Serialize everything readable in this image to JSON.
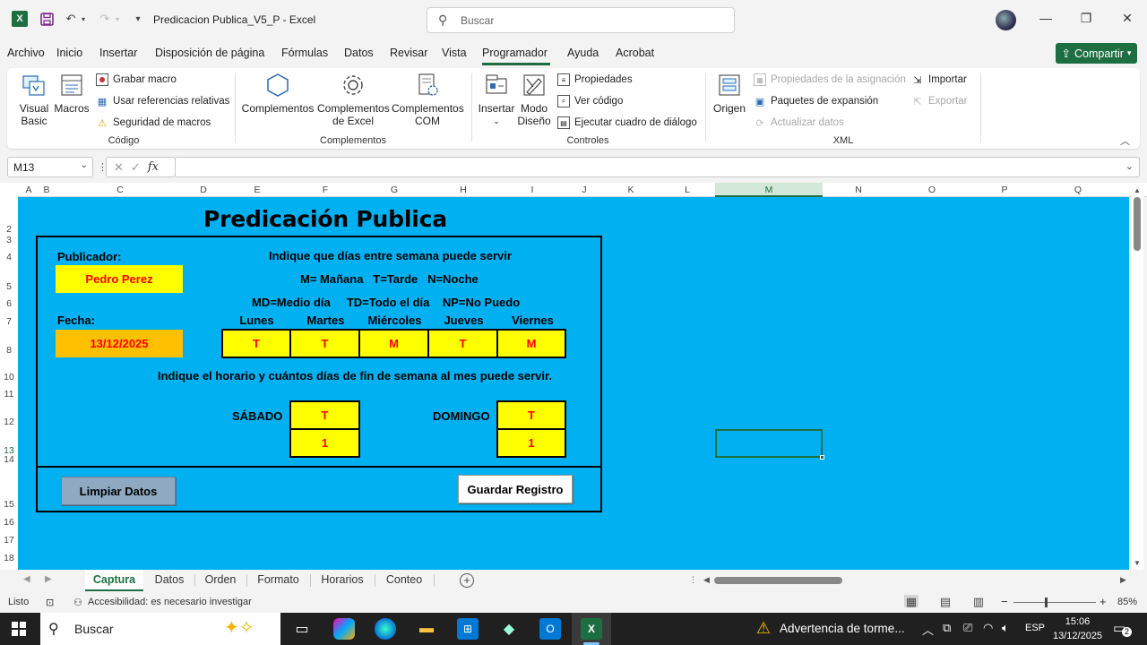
{
  "titlebar": {
    "app_letter": "X",
    "doc_title": "Predicacion Publica_V5_P  -  Excel",
    "search_placeholder": "Buscar"
  },
  "menu": {
    "items": [
      "Archivo",
      "Inicio",
      "Insertar",
      "Disposición de página",
      "Fórmulas",
      "Datos",
      "Revisar",
      "Vista",
      "Programador",
      "Ayuda",
      "Acrobat"
    ],
    "active": "Programador",
    "share_label": "Compartir"
  },
  "ribbon": {
    "codigo": {
      "visual_basic": "Visual Basic",
      "macros": "Macros",
      "grabar_macro": "Grabar macro",
      "usar_referencias": "Usar referencias relativas",
      "seguridad": "Seguridad de macros",
      "label": "Código"
    },
    "complementos": {
      "complementos": "Complementos",
      "complementos_excel": "Complementos de Excel",
      "complementos_com": "Complementos COM",
      "label": "Complementos"
    },
    "controles": {
      "insertar": "Insertar",
      "modo_diseno": "Modo Diseño",
      "propiedades": "Propiedades",
      "ver_codigo": "Ver código",
      "ejecutar_cuadro": "Ejecutar cuadro de diálogo",
      "label": "Controles"
    },
    "xml": {
      "origen": "Origen",
      "propiedades_asignacion": "Propiedades de la asignación",
      "paquetes_expansion": "Paquetes de expansión",
      "actualizar_datos": "Actualizar datos",
      "importar": "Importar",
      "exportar": "Exportar",
      "label": "XML"
    }
  },
  "formula_bar": {
    "name_box": "M13",
    "formula": ""
  },
  "columns": [
    "A",
    "B",
    "C",
    "D",
    "E",
    "F",
    "G",
    "H",
    "I",
    "J",
    "K",
    "L",
    "M",
    "N",
    "O",
    "P",
    "Q"
  ],
  "rows": [
    "2",
    "3",
    "4",
    "5",
    "6",
    "7",
    "8",
    "10",
    "11",
    "12",
    "13",
    "14",
    "15",
    "16",
    "17",
    "18"
  ],
  "sheet": {
    "title": "Predicación Publica",
    "publicador_label": "Publicador:",
    "publicador_value": "Pedro Perez",
    "fecha_label": "Fecha:",
    "fecha_value": "13/12/2025",
    "instruction_weekdays": "Indique que días entre semana puede servir",
    "legend_line1": "M= Mañana   T=Tarde   N=Noche",
    "legend_line2": "MD=Medio día     TD=Todo el día    NP=No Puedo",
    "days": [
      "Lunes",
      "Martes",
      "Miércoles",
      "Jueves",
      "Viernes"
    ],
    "day_values": [
      "T",
      "T",
      "M",
      "T",
      "M"
    ],
    "instruction_weekend": "Indique el horario y cuántos días de fin de semana al mes puede servir.",
    "sabado_label": "SÁBADO",
    "sabado_horario": "T",
    "sabado_dias": "1",
    "domingo_label": "DOMINGO",
    "domingo_horario": "T",
    "domingo_dias": "1",
    "btn_limpiar": "Limpiar Datos",
    "btn_guardar": "Guardar Registro"
  },
  "tabs": {
    "items": [
      "Captura",
      "Datos",
      "Orden",
      "Formato",
      "Horarios",
      "Conteo"
    ],
    "active": "Captura"
  },
  "statusbar": {
    "ready": "Listo",
    "accessibility": "Accesibilidad: es necesario investigar",
    "zoom": "85%"
  },
  "taskbar": {
    "search": "Buscar",
    "weather": "Advertencia de torme...",
    "language": "ESP",
    "time": "15:06",
    "date": "13/12/2025",
    "notifications": "2"
  },
  "colors": {
    "excel_green": "#1d6f42",
    "sheet_bg": "#00b0f0",
    "cell_yellow": "#ffff00",
    "cell_orange": "#ffc000",
    "value_red": "#ff0000"
  }
}
